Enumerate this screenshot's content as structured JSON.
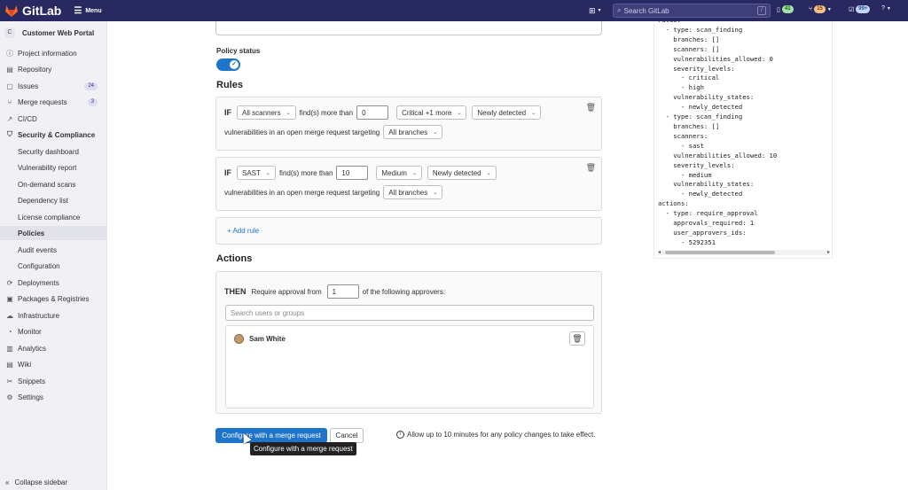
{
  "topbar": {
    "brand": "GitLab",
    "menu_label": "Menu",
    "search_placeholder": "Search GitLab",
    "search_shortcut": "/",
    "issues_count": "41",
    "mr_count": "15",
    "todo_count": "99+"
  },
  "sidebar": {
    "project_initial": "C",
    "project_name": "Customer Web Portal",
    "items": [
      {
        "label": "Project information",
        "icon": "info-icon"
      },
      {
        "label": "Repository",
        "icon": "doc-icon"
      },
      {
        "label": "Issues",
        "icon": "issues-icon",
        "count": "24"
      },
      {
        "label": "Merge requests",
        "icon": "merge-icon",
        "count": "3"
      },
      {
        "label": "CI/CD",
        "icon": "rocket-icon"
      },
      {
        "label": "Security & Compliance",
        "icon": "shield-icon"
      }
    ],
    "sub_items": [
      "Security dashboard",
      "Vulnerability report",
      "On-demand scans",
      "Dependency list",
      "License compliance",
      "Policies",
      "Audit events",
      "Configuration"
    ],
    "items2": [
      {
        "label": "Deployments",
        "icon": "deploy-icon"
      },
      {
        "label": "Packages & Registries",
        "icon": "package-icon"
      },
      {
        "label": "Infrastructure",
        "icon": "cloud-icon"
      },
      {
        "label": "Monitor",
        "icon": "monitor-icon"
      },
      {
        "label": "Analytics",
        "icon": "chart-icon"
      },
      {
        "label": "Wiki",
        "icon": "book-icon"
      },
      {
        "label": "Snippets",
        "icon": "scissors-icon"
      },
      {
        "label": "Settings",
        "icon": "gear-icon"
      }
    ],
    "collapse_label": "Collapse sidebar"
  },
  "policy": {
    "status_label": "Policy status",
    "rules_title": "Rules",
    "actions_title": "Actions",
    "rule1": {
      "if": "IF",
      "scanner": "All scanners",
      "finds": "find(s) more than",
      "count": "0",
      "severity": "Critical +1 more",
      "state": "Newly detected",
      "targeting": "vulnerabilities in an open merge request targeting",
      "branches": "All branches"
    },
    "rule2": {
      "if": "IF",
      "scanner": "SAST",
      "finds": "find(s) more than",
      "count": "10",
      "severity": "Medium",
      "state": "Newly detected",
      "targeting": "vulnerabilities in an open merge request targeting",
      "branches": "All branches"
    },
    "add_rule": "Add rule",
    "action": {
      "then": "THEN",
      "require": "Require approval from",
      "count": "1",
      "following": "of the following approvers:",
      "search_placeholder": "Search users or groups",
      "approver": "Sam White"
    },
    "primary_button": "Configure with a merge request",
    "cancel_button": "Cancel",
    "info": "Allow up to 10 minutes for any policy changes to take effect.",
    "tooltip": "Configure with a merge request"
  },
  "yaml": {
    "lines": [
      "rules:",
      "  - type: scan_finding",
      "    branches: []",
      "    scanners: []",
      "    vulnerabilities_allowed: 0",
      "    severity_levels:",
      "      - critical",
      "      - high",
      "    vulnerability_states:",
      "      - newly_detected",
      "  - type: scan_finding",
      "    branches: []",
      "    scanners:",
      "      - sast",
      "    vulnerabilities_allowed: 10",
      "    severity_levels:",
      "      - medium",
      "    vulnerability_states:",
      "      - newly_detected",
      "actions:",
      "  - type: require_approval",
      "    approvals_required: 1",
      "    user_approvers_ids:",
      "      - 5292351"
    ]
  }
}
